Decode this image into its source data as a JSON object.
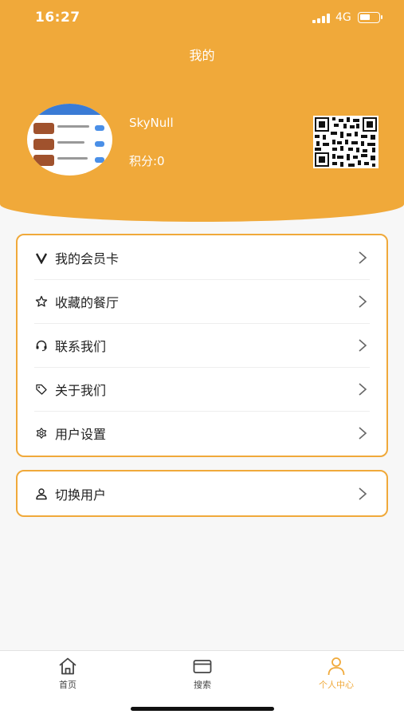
{
  "status_bar": {
    "time": "16:27",
    "network": "4G"
  },
  "header": {
    "title": "我的",
    "username": "SkyNull",
    "points_label": "积分:0"
  },
  "menu": {
    "items": [
      {
        "icon": "v-icon",
        "label": "我的会员卡"
      },
      {
        "icon": "star-icon",
        "label": "收藏的餐厅"
      },
      {
        "icon": "headset-icon",
        "label": "联系我们"
      },
      {
        "icon": "tag-icon",
        "label": "关于我们"
      },
      {
        "icon": "settings-flower-icon",
        "label": "用户设置"
      }
    ],
    "switch_user": {
      "icon": "user-icon",
      "label": "切换用户"
    }
  },
  "tabbar": {
    "tabs": [
      {
        "icon": "home-icon",
        "label": "首页"
      },
      {
        "icon": "card-icon",
        "label": "搜索"
      },
      {
        "icon": "person-icon",
        "label": "个人中心",
        "active": true
      }
    ]
  },
  "colors": {
    "accent": "#f0a93a",
    "background": "#f7f7f7"
  }
}
